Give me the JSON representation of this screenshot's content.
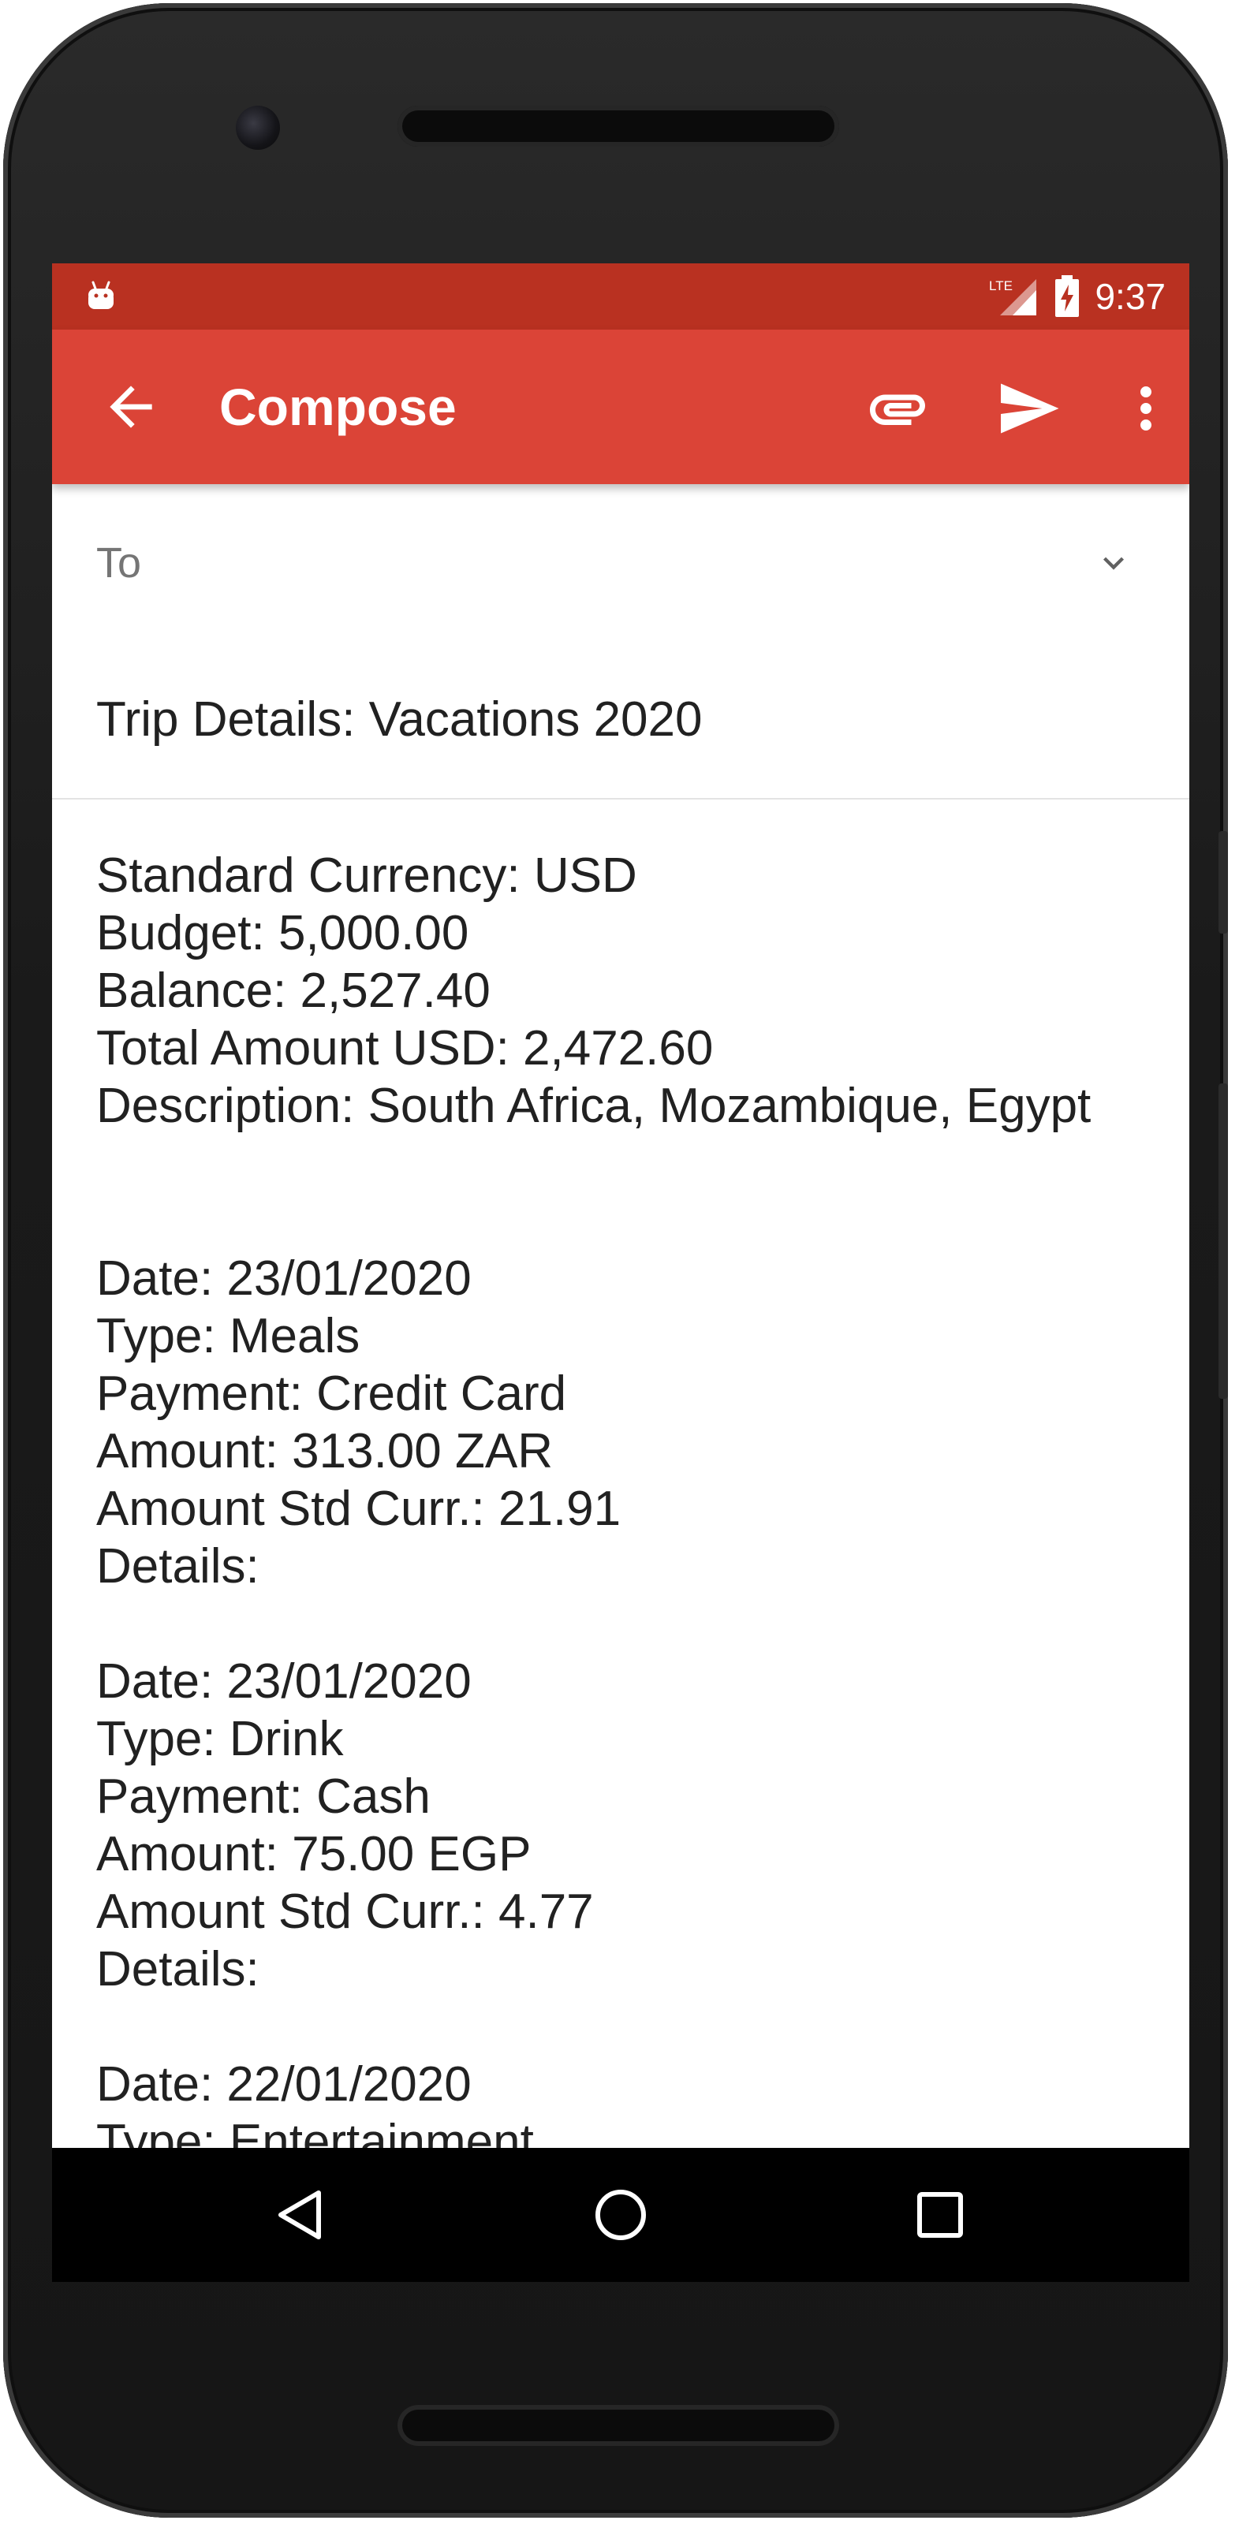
{
  "status_bar": {
    "network": "LTE",
    "time": "9:37"
  },
  "app_bar": {
    "title": "Compose",
    "icons": [
      "back-arrow-icon",
      "attach-icon",
      "send-icon",
      "more-vert-icon"
    ]
  },
  "compose": {
    "to_label": "To",
    "subject": "Trip Details: Vacations 2020",
    "body": "Standard Currency: USD\nBudget: 5,000.00\nBalance: 2,527.40\nTotal Amount USD: 2,472.60\nDescription: South Africa, Mozambique, Egypt\n\n\nDate: 23/01/2020\nType: Meals\nPayment: Credit Card\nAmount: 313.00 ZAR\nAmount Std Curr.: 21.91\nDetails:\n\nDate: 23/01/2020\nType: Drink\nPayment: Cash\nAmount: 75.00 EGP\nAmount Std Curr.: 4.77\nDetails:\n\nDate: 22/01/2020\nType: Entertainment"
  },
  "nav_bar": {
    "icons": [
      "back-triangle-icon",
      "home-circle-icon",
      "recents-square-icon"
    ]
  },
  "colors": {
    "status_bar": "#b93121",
    "app_bar": "#db4437",
    "text_primary": "#212121",
    "text_hint": "#757575"
  }
}
